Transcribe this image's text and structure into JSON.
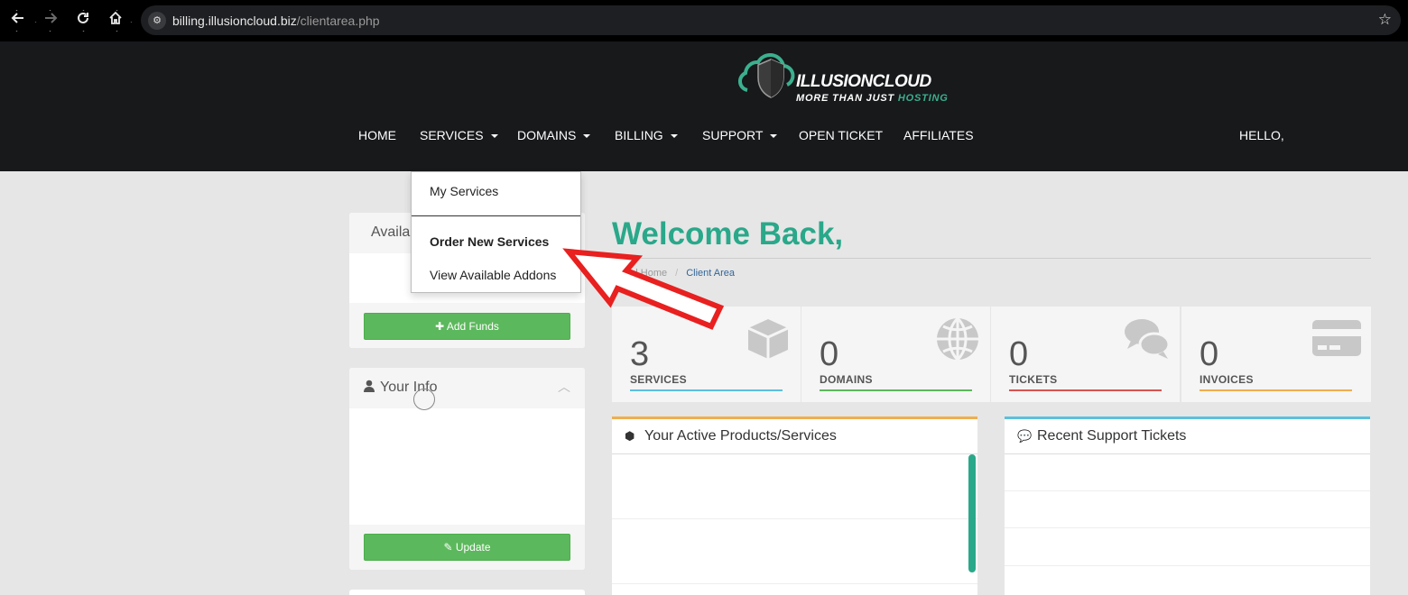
{
  "browser": {
    "url_host": "billing.illusioncloud.biz",
    "url_path": "/clientarea.php",
    "back_icon": "arrow-left-icon",
    "forward_icon": "arrow-right-icon",
    "reload_icon": "reload-icon",
    "home_icon": "home-icon",
    "bookmark_icon": "star-icon"
  },
  "brand": {
    "name": "ILLUSIONCLOUD",
    "tagline_main": "MORE THAN JUST",
    "tagline_accent": "HOSTING",
    "accent_color": "#3bb08f"
  },
  "nav": {
    "home": "HOME",
    "services": "SERVICES",
    "domains": "DOMAINS",
    "billing": "BILLING",
    "support": "SUPPORT",
    "open_ticket": "OPEN TICKET",
    "affiliates": "AFFILIATES",
    "hello": "HELLO,"
  },
  "services_dropdown": {
    "items": [
      "My Services",
      "Order New Services",
      "View Available Addons"
    ]
  },
  "sidebar": {
    "funds_title": "Availa",
    "add_funds": "Add Funds",
    "your_info_title": "Your Info",
    "update": "Update"
  },
  "main": {
    "welcome": "Welcome Back,",
    "breadcrumb_home": "Portal Home",
    "breadcrumb_active": "Client Area",
    "stats": [
      {
        "count": "3",
        "label": "SERVICES",
        "color": "#5bc0de",
        "icon": "cube-icon"
      },
      {
        "count": "0",
        "label": "DOMAINS",
        "color": "#5cb85c",
        "icon": "globe-icon"
      },
      {
        "count": "0",
        "label": "TICKETS",
        "color": "#d9534f",
        "icon": "comments-icon"
      },
      {
        "count": "0",
        "label": "INVOICES",
        "color": "#f0ad4e",
        "icon": "credit-card-icon"
      }
    ],
    "products_title": "Your Active Products/Services",
    "tickets_title": "Recent Support Tickets"
  },
  "colors": {
    "brand_green": "#2aa88a",
    "header_bg": "#17191b",
    "button_green": "#5cb85c",
    "annotation_arrow": "#e8201f"
  }
}
